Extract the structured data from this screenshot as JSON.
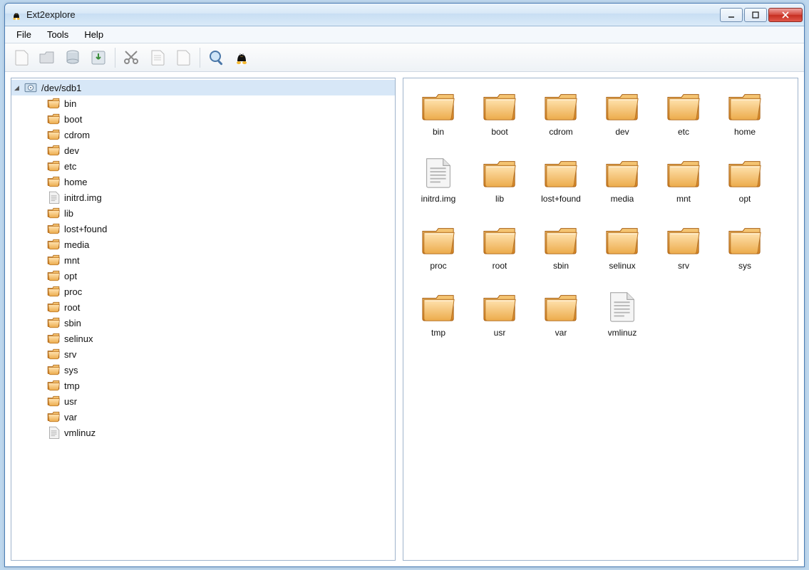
{
  "window": {
    "title": "Ext2explore"
  },
  "menu": {
    "items": [
      "File",
      "Tools",
      "Help"
    ]
  },
  "toolbar": {
    "buttons": [
      {
        "name": "new-file-icon"
      },
      {
        "name": "open-icon"
      },
      {
        "name": "drive-icon"
      },
      {
        "name": "save-icon"
      },
      {
        "sep": true
      },
      {
        "name": "cut-icon"
      },
      {
        "name": "copy-icon"
      },
      {
        "name": "paste-icon"
      },
      {
        "sep": true
      },
      {
        "name": "search-icon"
      },
      {
        "name": "tux-icon"
      }
    ]
  },
  "tree": {
    "root": {
      "label": "/dev/sdb1",
      "expanded": true,
      "icon": "disk",
      "selected": true
    },
    "children": [
      {
        "label": "bin",
        "icon": "folder"
      },
      {
        "label": "boot",
        "icon": "folder"
      },
      {
        "label": "cdrom",
        "icon": "folder"
      },
      {
        "label": "dev",
        "icon": "folder"
      },
      {
        "label": "etc",
        "icon": "folder"
      },
      {
        "label": "home",
        "icon": "folder"
      },
      {
        "label": "initrd.img",
        "icon": "file"
      },
      {
        "label": "lib",
        "icon": "folder"
      },
      {
        "label": "lost+found",
        "icon": "folder"
      },
      {
        "label": "media",
        "icon": "folder"
      },
      {
        "label": "mnt",
        "icon": "folder"
      },
      {
        "label": "opt",
        "icon": "folder"
      },
      {
        "label": "proc",
        "icon": "folder"
      },
      {
        "label": "root",
        "icon": "folder"
      },
      {
        "label": "sbin",
        "icon": "folder"
      },
      {
        "label": "selinux",
        "icon": "folder"
      },
      {
        "label": "srv",
        "icon": "folder"
      },
      {
        "label": "sys",
        "icon": "folder"
      },
      {
        "label": "tmp",
        "icon": "folder"
      },
      {
        "label": "usr",
        "icon": "folder"
      },
      {
        "label": "var",
        "icon": "folder"
      },
      {
        "label": "vmlinuz",
        "icon": "file"
      }
    ]
  },
  "grid": {
    "items": [
      {
        "label": "bin",
        "icon": "folder"
      },
      {
        "label": "boot",
        "icon": "folder"
      },
      {
        "label": "cdrom",
        "icon": "folder"
      },
      {
        "label": "dev",
        "icon": "folder"
      },
      {
        "label": "etc",
        "icon": "folder"
      },
      {
        "label": "home",
        "icon": "folder"
      },
      {
        "label": "initrd.img",
        "icon": "file"
      },
      {
        "label": "lib",
        "icon": "folder"
      },
      {
        "label": "lost+found",
        "icon": "folder"
      },
      {
        "label": "media",
        "icon": "folder"
      },
      {
        "label": "mnt",
        "icon": "folder"
      },
      {
        "label": "opt",
        "icon": "folder"
      },
      {
        "label": "proc",
        "icon": "folder"
      },
      {
        "label": "root",
        "icon": "folder"
      },
      {
        "label": "sbin",
        "icon": "folder"
      },
      {
        "label": "selinux",
        "icon": "folder"
      },
      {
        "label": "srv",
        "icon": "folder"
      },
      {
        "label": "sys",
        "icon": "folder"
      },
      {
        "label": "tmp",
        "icon": "folder"
      },
      {
        "label": "usr",
        "icon": "folder"
      },
      {
        "label": "var",
        "icon": "folder"
      },
      {
        "label": "vmlinuz",
        "icon": "file"
      }
    ]
  }
}
